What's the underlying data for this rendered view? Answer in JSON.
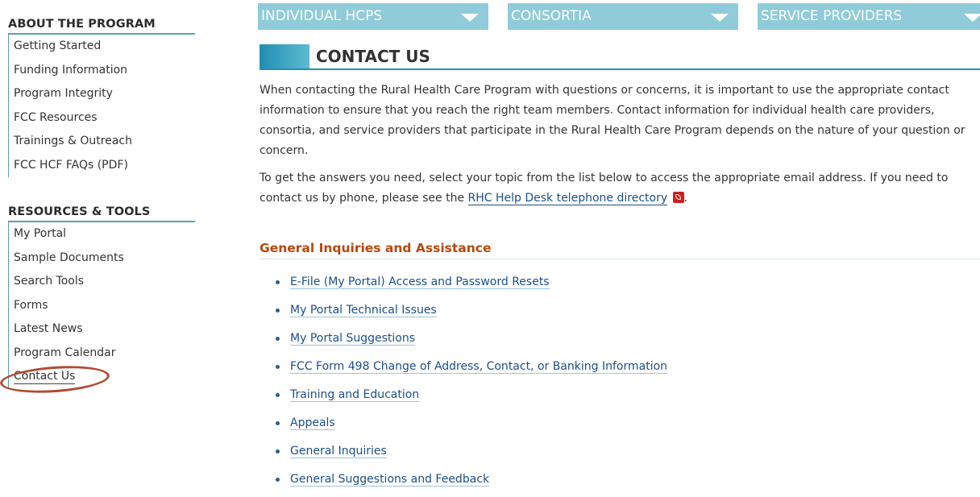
{
  "sidebar": {
    "about": {
      "heading": "ABOUT THE PROGRAM",
      "items": [
        "Getting Started",
        "Funding Information",
        "Program Integrity",
        "FCC Resources",
        "Trainings & Outreach",
        "FCC HCF FAQs (PDF)"
      ]
    },
    "resources": {
      "heading": "RESOURCES & TOOLS",
      "items": [
        "My Portal",
        "Sample Documents",
        "Search Tools",
        "Forms",
        "Latest News",
        "Program Calendar",
        "Contact Us"
      ]
    }
  },
  "nav": {
    "tabs": [
      "INDIVIDUAL HCPS",
      "CONSORTIA",
      "SERVICE PROVIDERS"
    ]
  },
  "page": {
    "title": "CONTACT US",
    "para1": "When contacting the Rural Health Care Program with questions or concerns, it is important to use the appropriate contact information to ensure that you reach the right team members. Contact information for individual health care providers, consortia, and service providers that participate in the Rural Health Care Program depends on the nature of your question or concern.",
    "para2_before": "To get the answers you need, select your topic from the list below to access the appropriate email address. If you need to contact us by phone, please see the ",
    "para2_link": "RHC Help Desk telephone directory",
    "para2_after": "."
  },
  "general": {
    "heading": "General Inquiries and Assistance",
    "items": [
      "E-File (My Portal) Access and Password Resets",
      "My Portal Technical Issues",
      "My Portal Suggestions",
      "FCC Form 498 Change of Address, Contact, or Banking Information",
      "Training and Education",
      "Appeals",
      "General Inquiries",
      "General Suggestions and Feedback"
    ]
  },
  "colors": {
    "nav_tab": "#8fcbd9",
    "accent_blue": "#2a8fb0",
    "section_orange": "#b8470b",
    "highlight_ring": "#b34a33"
  }
}
